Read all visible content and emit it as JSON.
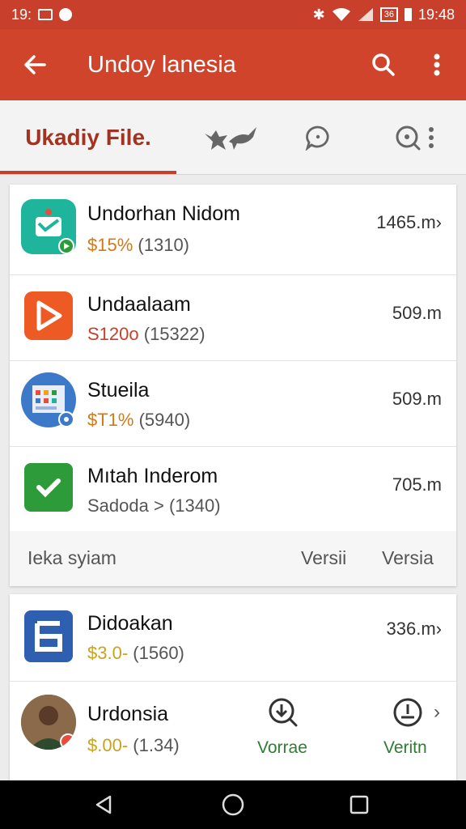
{
  "status_bar": {
    "left_text": "19:",
    "time": "19:48",
    "battery": "36"
  },
  "app_bar": {
    "title": "Undoy lanesia"
  },
  "tabs": {
    "active_label": "Ukadiy File."
  },
  "apps": [
    {
      "name": "Undorhan Nidom",
      "price": "$15%",
      "count": "(1310)",
      "size": "1465.m",
      "chevron": "›",
      "icon": "chat-app-icon",
      "icon_color": "#1fb59d"
    },
    {
      "name": "Undaalaam",
      "price": "S120o",
      "count": "(15322)",
      "size": "509.m",
      "chevron": "",
      "icon": "play-app-icon",
      "icon_color": "#ee5a24"
    },
    {
      "name": "Stueila",
      "price": "$T1%",
      "count": "(5940)",
      "size": "509.m",
      "chevron": "",
      "icon": "calendar-app-icon",
      "icon_color": "#3d79c9"
    },
    {
      "name": "Mıtah Inderom",
      "price": "Sadoda",
      "count": "> (1340)",
      "size": "705.m",
      "chevron": "",
      "icon": "arrow-app-icon",
      "icon_color": "#2e9b3a"
    }
  ],
  "footer": {
    "left": "Ieka syiam",
    "mid": "Versii",
    "right": "Versia"
  },
  "apps2": [
    {
      "name": "Didoakan",
      "price": "$3.0-",
      "count": "(1560)",
      "size": "336.m",
      "chevron": "›",
      "icon": "six-app-icon",
      "icon_color": "#2e5fb0"
    },
    {
      "name": "Urdonsia",
      "price": "$.00-",
      "count": "(1.34)",
      "icon": "person-avatar"
    }
  ],
  "actions": {
    "verse_label": "Vorrae",
    "verity_label": "Veritn",
    "chevron": "›"
  },
  "colors": {
    "primary": "#d0442c",
    "status": "#c8402b",
    "tab_active": "#a33321"
  }
}
